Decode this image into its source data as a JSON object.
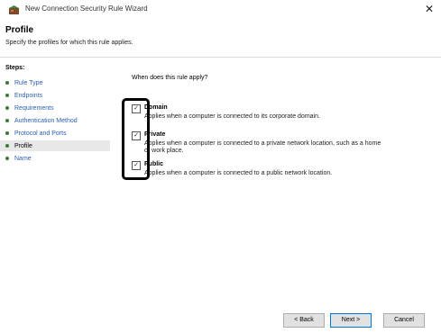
{
  "window": {
    "title": "New Connection Security Rule Wizard",
    "close_label": "✕"
  },
  "header": {
    "title": "Profile",
    "description": "Specify the profiles for which this rule applies."
  },
  "steps": {
    "label": "Steps:",
    "items": [
      {
        "label": "Rule Type"
      },
      {
        "label": "Endpoints"
      },
      {
        "label": "Requirements"
      },
      {
        "label": "Authentication Method"
      },
      {
        "label": "Protocol and Ports"
      },
      {
        "label": "Profile"
      },
      {
        "label": "Name"
      }
    ],
    "current": "Profile"
  },
  "content": {
    "question": "When does this rule apply?",
    "options": [
      {
        "label": "Domain",
        "checked": true,
        "description": "Applies when a computer is connected to its corporate domain."
      },
      {
        "label": "Private",
        "checked": true,
        "description": "Applies when a computer is connected to a private network location, such as a home or work place."
      },
      {
        "label": "Public",
        "checked": true,
        "description": "Applies when a computer is connected to a public network location."
      }
    ]
  },
  "buttons": {
    "back": "< Back",
    "next": "Next >",
    "cancel": "Cancel"
  }
}
